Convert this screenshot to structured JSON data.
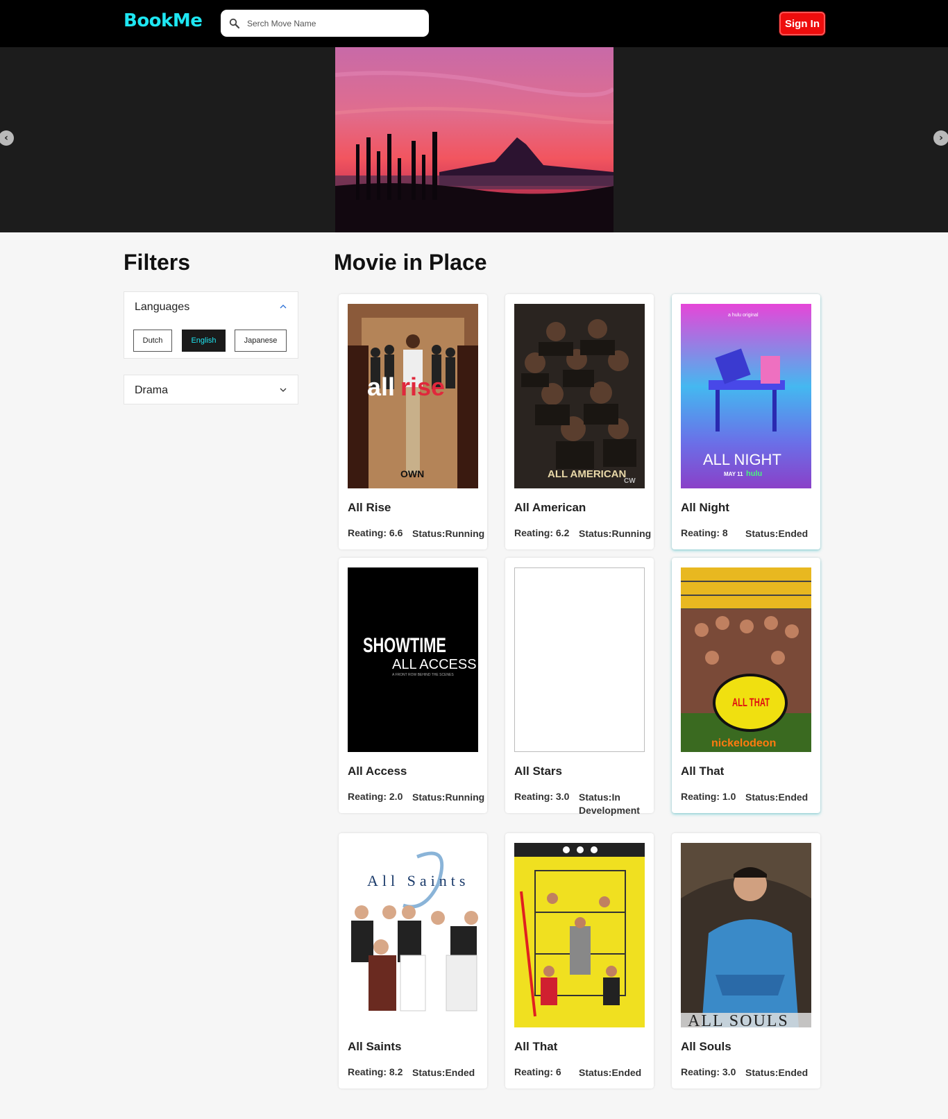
{
  "header": {
    "logo": "BookMe",
    "search_placeholder": "Serch Move Name",
    "signin_label": "Sign In"
  },
  "filters": {
    "title": "Filters",
    "languages": {
      "label": "Languages",
      "options": [
        "Dutch",
        "English",
        "Japanese"
      ],
      "selected": "English"
    },
    "genre": {
      "label": "Drama"
    }
  },
  "movies": {
    "title": "Movie in Place",
    "rating_prefix": "Reating:",
    "status_prefix": "Status:",
    "items": [
      {
        "name": "All Rise",
        "rating": "6.6",
        "status": "Running"
      },
      {
        "name": "All American",
        "rating": "6.2",
        "status": "Running"
      },
      {
        "name": "All Night",
        "rating": "8",
        "status": "Ended"
      },
      {
        "name": "All Access",
        "rating": "2.0",
        "status": "Running"
      },
      {
        "name": "All Stars",
        "rating": "3.0",
        "status": "In Development"
      },
      {
        "name": "All That",
        "rating": "1.0",
        "status": "Ended"
      },
      {
        "name": "All Saints",
        "rating": "8.2",
        "status": "Ended"
      },
      {
        "name": "All That",
        "rating": "6",
        "status": "Ended"
      },
      {
        "name": "All Souls",
        "rating": "3.0",
        "status": "Ended"
      }
    ]
  },
  "posters": {
    "all_rise": {
      "text_a": "all",
      "text_b": "rise",
      "network": "OWN"
    },
    "all_american": {
      "text": "ALL AMERICAN",
      "network": "CW"
    },
    "all_night": {
      "brand": "a hulu original",
      "text": "ALL NIGHT",
      "sub": "MAY 11",
      "network": "hulu"
    },
    "all_access": {
      "brand": "SHOWTIME",
      "text": "ALL ACCESS",
      "sub": "A FRONT ROW BEHIND THE SCENES"
    },
    "all_that": {
      "logo": "ALL THAT",
      "network": "nickelodeon"
    },
    "all_saints": {
      "text": "All Saints"
    },
    "all_souls": {
      "text": "ALL SOULS"
    }
  },
  "colors": {
    "accent": "#1ee6f2",
    "signin": "#ee0d0d",
    "header_bg": "#000000",
    "hero_bg": "#1c1c1c",
    "page_bg": "#f6f6f6"
  }
}
